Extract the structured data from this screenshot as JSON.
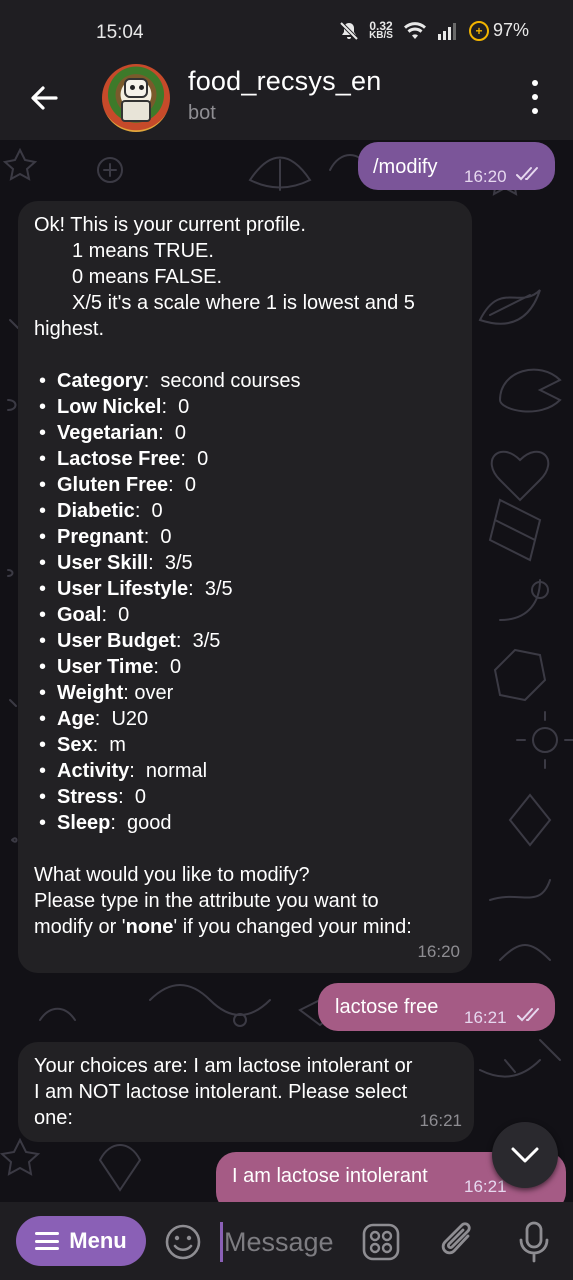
{
  "status_bar": {
    "time": "15:04",
    "net_speed_value": "0.32",
    "net_speed_unit": "KB/S",
    "battery": "97%",
    "battery_badge": "+"
  },
  "header": {
    "title": "food_recsys_en",
    "subtitle": "bot"
  },
  "messages": {
    "m1": {
      "text": "/modify",
      "time": "16:20"
    },
    "m2": {
      "intro": "Ok! This is your current profile.",
      "legend": [
        "1 means TRUE.",
        "0 means FALSE.",
        "X/5 it's a scale where 1 is lowest and 5"
      ],
      "legend_tail": "highest.",
      "bullet": "•",
      "attributes": [
        {
          "key": "Category",
          "sep": ":  ",
          "value": "second courses"
        },
        {
          "key": "Low Nickel",
          "sep": ":  ",
          "value": "0"
        },
        {
          "key": "Vegetarian",
          "sep": ":  ",
          "value": "0"
        },
        {
          "key": "Lactose Free",
          "sep": ":  ",
          "value": "0"
        },
        {
          "key": "Gluten Free",
          "sep": ":  ",
          "value": "0"
        },
        {
          "key": "Diabetic",
          "sep": ":  ",
          "value": "0"
        },
        {
          "key": "Pregnant",
          "sep": ":  ",
          "value": "0"
        },
        {
          "key": "User Skill",
          "sep": ":  ",
          "value": "3/5"
        },
        {
          "key": "User Lifestyle",
          "sep": ":  ",
          "value": "3/5"
        },
        {
          "key": "Goal",
          "sep": ":  ",
          "value": "0"
        },
        {
          "key": "User Budget",
          "sep": ":  ",
          "value": "3/5"
        },
        {
          "key": "User Time",
          "sep": ":  ",
          "value": "0"
        },
        {
          "key": "Weight",
          "sep": ": ",
          "value": "over"
        },
        {
          "key": "Age",
          "sep": ":  ",
          "value": "U20"
        },
        {
          "key": "Sex",
          "sep": ":  ",
          "value": "m"
        },
        {
          "key": "Activity",
          "sep": ":  ",
          "value": "normal"
        },
        {
          "key": "Stress",
          "sep": ":  ",
          "value": "0"
        },
        {
          "key": "Sleep",
          "sep": ":  ",
          "value": "good"
        }
      ],
      "question": "What would you like to modify?",
      "instruction_1": "Please type in the attribute you want to",
      "instruction_2_pre": "modify or '",
      "instruction_2_bold": "none",
      "instruction_2_post": "' if you changed your mind:",
      "time": "16:20"
    },
    "m3": {
      "text": "lactose free",
      "time": "16:21"
    },
    "m4": {
      "lines": [
        "Your choices are: I am lactose intolerant or",
        "I am NOT lactose intolerant. Please select",
        "one:"
      ],
      "time": "16:21"
    },
    "m5": {
      "text": "I am lactose intolerant",
      "time": "16:21"
    }
  },
  "input_bar": {
    "menu_label": "Menu",
    "placeholder": "Message"
  },
  "colors": {
    "accent": "#8a60b6",
    "outgoing_bubble": "#7b5599",
    "outgoing_bubble_alt": "#a55b85",
    "incoming_bubble": "#222124",
    "bar_bg": "#1f1e22"
  }
}
